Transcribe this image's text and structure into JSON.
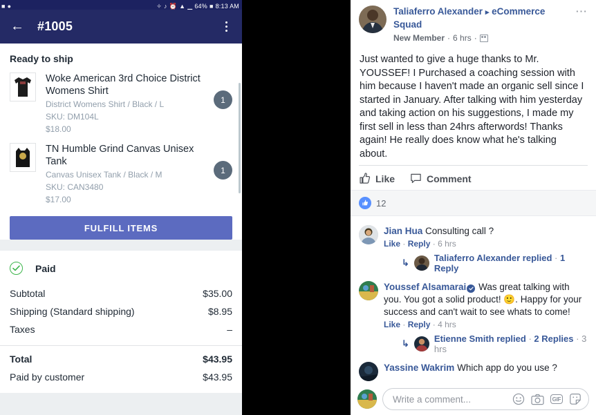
{
  "phone": {
    "statusbar": {
      "left_icons": [
        "camera-icon",
        "messenger-icon"
      ],
      "right_icons": [
        "bluetooth-icon",
        "mute-icon",
        "alarm-icon",
        "wifi-icon",
        "signal-icon"
      ],
      "battery": "64%",
      "time": "8:13 AM"
    },
    "appbar": {
      "back_icon": "←",
      "title": "#1005",
      "menu_icon": "overflow-menu"
    },
    "fulfillment": {
      "section_title": "Ready to ship",
      "items": [
        {
          "title": "Woke American 3rd Choice District Womens Shirt",
          "variant": "District Womens Shirt / Black / L",
          "sku": "SKU: DM104L",
          "price": "$18.00",
          "qty": "1"
        },
        {
          "title": "TN Humble Grind Canvas Unisex Tank",
          "variant": "Canvas Unisex Tank / Black / M",
          "sku": "SKU: CAN3480",
          "price": "$17.00",
          "qty": "1"
        }
      ],
      "fulfill_button": "FULFILL ITEMS"
    },
    "payment": {
      "status": "Paid",
      "rows": [
        {
          "label": "Subtotal",
          "value": "$35.00"
        },
        {
          "label": "Shipping (Standard shipping)",
          "value": "$8.95"
        },
        {
          "label": "Taxes",
          "value": "–"
        }
      ],
      "total": {
        "label": "Total",
        "value": "$43.95"
      },
      "paid_by_customer": {
        "label": "Paid by customer",
        "value": "$43.95"
      }
    },
    "colors": {
      "appbar": "#242a65",
      "accent_button": "#5c6bc0",
      "qty_badge": "#5b6b7b",
      "paid_check": "#3bb54a"
    }
  },
  "facebook": {
    "post": {
      "author": "Taliaferro Alexander",
      "arrow": "▸",
      "group": "eCommerce Squad",
      "member_status": "New Member",
      "time": "6 hrs",
      "audience_icon": "group-audience-icon",
      "menu_icon": "⋯",
      "body": "Just wanted to give a huge thanks to Mr. YOUSSEF! I Purchased a coaching session with him because I haven't made an organic sell since I started in January. After talking with him yesterday and taking action on his suggestions, I made my first sell in less than 24hrs afterwords! Thanks again! He really does know what he's talking about."
    },
    "actions": {
      "like": "Like",
      "comment": "Comment"
    },
    "reactions": {
      "count": "12",
      "icon": "like-reaction-icon"
    },
    "comments": [
      {
        "author": "Jian Hua",
        "verified": false,
        "text": "Consulting call ?",
        "like": "Like",
        "reply": "Reply",
        "time": "6 hrs",
        "thread": {
          "who": "Taliaferro Alexander replied",
          "count": "1 Reply",
          "time": ""
        }
      },
      {
        "author": "Youssef Alsamarai",
        "verified": true,
        "text": "Was great talking with you. You got a solid product! 🙂. Happy for your success and can't wait to see whats to come!",
        "like": "Like",
        "reply": "Reply",
        "time": "4 hrs",
        "thread": {
          "who": "Etienne Smith replied",
          "count": "2 Replies",
          "time": "3 hrs"
        }
      },
      {
        "author": "Yassine Wakrim",
        "verified": false,
        "text": "Which app do you use ?",
        "like": "",
        "reply": "",
        "time": "",
        "thread": null
      }
    ],
    "composer": {
      "placeholder": "Write a comment...",
      "icons": [
        "emoji-icon",
        "camera-icon",
        "gif-icon",
        "sticker-icon"
      ],
      "gif_label": "GIF"
    },
    "colors": {
      "link": "#385898",
      "reaction_blue": "#5890ff"
    }
  }
}
